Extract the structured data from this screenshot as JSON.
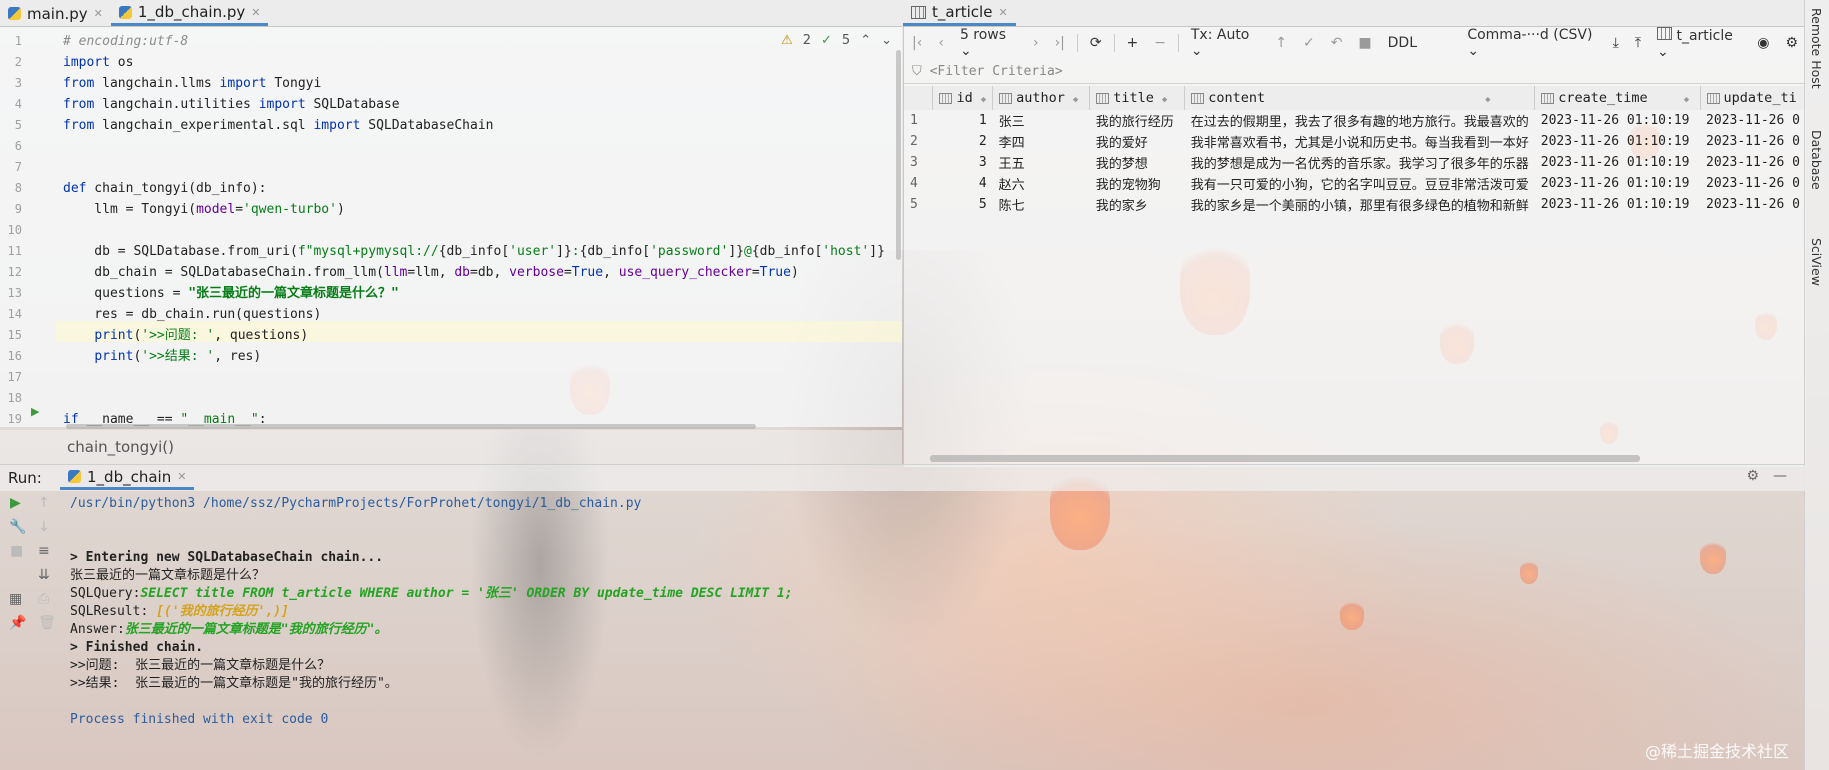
{
  "editor": {
    "tabs": [
      {
        "label": "main.py",
        "active": false
      },
      {
        "label": "1_db_chain.py",
        "active": true
      }
    ],
    "inspections": {
      "warnings": "2",
      "ok": "5"
    },
    "lines": [
      {
        "n": "1",
        "html": "<span class=\"cm\"># encoding:utf-8</span>"
      },
      {
        "n": "2",
        "html": "<span class=\"kw\">import</span> os"
      },
      {
        "n": "3",
        "html": "<span class=\"kw\">from</span> langchain.llms <span class=\"kw\">import</span> Tongyi"
      },
      {
        "n": "4",
        "html": "<span class=\"kw\">from</span> langchain.utilities <span class=\"kw\">import</span> SQLDatabase"
      },
      {
        "n": "5",
        "html": "<span class=\"kw\">from</span> langchain_experimental.sql <span class=\"kw\">import</span> SQLDatabaseChain"
      },
      {
        "n": "6",
        "html": ""
      },
      {
        "n": "7",
        "html": ""
      },
      {
        "n": "8",
        "html": "<span class=\"kw\">def</span> chain_tongyi(db_info):"
      },
      {
        "n": "9",
        "html": "    llm = Tongyi(<span class=\"kwa\">model</span>=<span class=\"str\">'qwen-turbo'</span>)"
      },
      {
        "n": "10",
        "html": ""
      },
      {
        "n": "11",
        "html": "    db = SQLDatabase.from_uri(<span class=\"str\">f\"mysql+pymysql://</span>{db_info[<span class=\"str\">'user'</span>]}<span class=\"str\">:</span>{db_info[<span class=\"str\">'password'</span>]}<span class=\"str\">@</span>{db_info[<span class=\"str\">'host'</span>]}"
      },
      {
        "n": "12",
        "html": "    db_chain = SQLDatabaseChain.from_llm(<span class=\"kwa\">llm</span>=llm, <span class=\"kwa\">db</span>=db, <span class=\"kwa\">verbose</span>=<span class=\"kw\">True</span>, <span class=\"kwa\">use_query_checker</span>=<span class=\"kw\">True</span>)"
      },
      {
        "n": "13",
        "html": "    questions = <span class=\"strb\">\"张三最近的一篇文章标题是什么？\"</span>"
      },
      {
        "n": "14",
        "html": "    res = db_chain.run(questions)"
      },
      {
        "n": "15",
        "html": "    <span class=\"kw\">print</span>(<span class=\"str\">'>>问题: '</span>, questions)"
      },
      {
        "n": "16",
        "html": "    <span class=\"kw\">print</span>(<span class=\"str\">'>>结果: '</span>, res)"
      },
      {
        "n": "17",
        "html": ""
      },
      {
        "n": "18",
        "html": ""
      },
      {
        "n": "19",
        "html": "<span class=\"kw\">if</span> __name__ == <span class=\"str\">\"__main__\"</span>:"
      }
    ],
    "breadcrumb": "chain_tongyi()"
  },
  "db": {
    "tab": "t_article",
    "toolbar": {
      "rows": "5 rows",
      "tx": "Tx: Auto",
      "ddl": "DDL",
      "format": "Comma-···d (CSV)",
      "table": "t_article"
    },
    "filter_placeholder": "<Filter Criteria>",
    "columns": [
      "id",
      "author",
      "title",
      "content",
      "create_time",
      "update_ti"
    ],
    "rows": [
      {
        "rn": "1",
        "id": "1",
        "author": "张三",
        "title": "我的旅行经历",
        "content": "在过去的假期里，我去了很多有趣的地方旅行。我最喜欢的",
        "create_time": "2023-11-26 01:10:19",
        "update_time": "2023-11-26 0"
      },
      {
        "rn": "2",
        "id": "2",
        "author": "李四",
        "title": "我的爱好",
        "content": "我非常喜欢看书，尤其是小说和历史书。每当我看到一本好",
        "create_time": "2023-11-26 01:10:19",
        "update_time": "2023-11-26 0"
      },
      {
        "rn": "3",
        "id": "3",
        "author": "王五",
        "title": "我的梦想",
        "content": "我的梦想是成为一名优秀的音乐家。我学习了很多年的乐器",
        "create_time": "2023-11-26 01:10:19",
        "update_time": "2023-11-26 0"
      },
      {
        "rn": "4",
        "id": "4",
        "author": "赵六",
        "title": "我的宠物狗",
        "content": "我有一只可爱的小狗，它的名字叫豆豆。豆豆非常活泼可爱",
        "create_time": "2023-11-26 01:10:19",
        "update_time": "2023-11-26 0"
      },
      {
        "rn": "5",
        "id": "5",
        "author": "陈七",
        "title": "我的家乡",
        "content": "我的家乡是一个美丽的小镇，那里有很多绿色的植物和新鲜",
        "create_time": "2023-11-26 01:10:19",
        "update_time": "2023-11-26 0"
      }
    ]
  },
  "side": {
    "labels": [
      "Remote Host",
      "Database",
      "SciView"
    ]
  },
  "run": {
    "label": "Run:",
    "tab": "1_db_chain",
    "console": [
      {
        "cls": "cl-path",
        "text": "/usr/bin/python3 /home/ssz/PycharmProjects/ForProhet/tongyi/1_db_chain.py"
      },
      {
        "cls": "",
        "text": ""
      },
      {
        "cls": "",
        "text": ""
      },
      {
        "cls": "cl-bold",
        "text": "> Entering new SQLDatabaseChain chain..."
      },
      {
        "cls": "",
        "text": "张三最近的一篇文章标题是什么？"
      },
      {
        "cls": "",
        "text": "SQLQuery:",
        "extra_cls": "cl-green",
        "extra": "SELECT title FROM t_article WHERE author = '张三' ORDER BY update_time DESC LIMIT 1;"
      },
      {
        "cls": "",
        "text": "SQLResult: ",
        "extra_cls": "cl-yellow",
        "extra": "[('我的旅行经历',)]"
      },
      {
        "cls": "",
        "text": "Answer:",
        "extra_cls": "cl-green",
        "extra": "张三最近的一篇文章标题是\"我的旅行经历\"。"
      },
      {
        "cls": "cl-bold",
        "text": "> Finished chain."
      },
      {
        "cls": "",
        "text": ">>问题:  张三最近的一篇文章标题是什么？"
      },
      {
        "cls": "",
        "text": ">>结果:  张三最近的一篇文章标题是\"我的旅行经历\"。"
      },
      {
        "cls": "",
        "text": ""
      },
      {
        "cls": "cl-blue",
        "text": "Process finished with exit code 0"
      }
    ]
  },
  "watermark": "@稀土掘金技术社区"
}
